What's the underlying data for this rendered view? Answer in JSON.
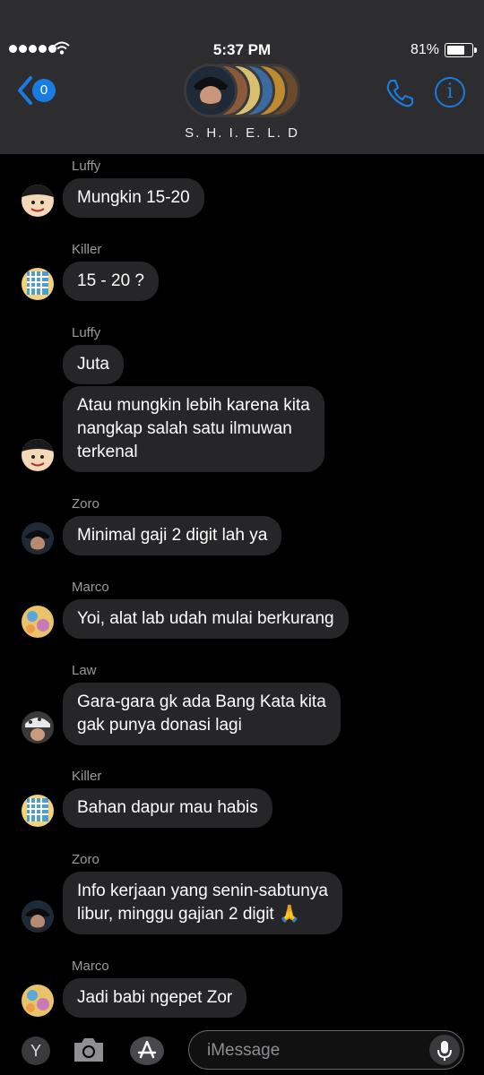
{
  "status": {
    "time": "5:37 PM",
    "battery": "81%",
    "battery_level": 0.81
  },
  "header": {
    "back_badge": "0",
    "group_name": "S. H. I. E. L. D",
    "info_label": "i"
  },
  "messages": [
    {
      "sender": "Luffy",
      "text": "Mungkin 15-20"
    },
    {
      "sender": "Killer",
      "text": "15 - 20  ?"
    },
    {
      "sender": "Luffy",
      "text": "Juta"
    },
    {
      "sender": "",
      "text": "Atau mungkin lebih karena kita\nnangkap salah satu ilmuwan\nterkenal"
    },
    {
      "sender": "Zoro",
      "text": "Minimal gaji 2 digit lah ya"
    },
    {
      "sender": "Marco",
      "text": "Yoi, alat lab udah mulai berkurang"
    },
    {
      "sender": "Law",
      "text": "Gara-gara gk ada Bang Kata kita\ngak punya donasi lagi"
    },
    {
      "sender": "Killer",
      "text": "Bahan dapur mau habis"
    },
    {
      "sender": "Zoro",
      "text": "Info kerjaan yang senin-sabtunya\nlibur, minggu gajian 2 digit 🙏"
    },
    {
      "sender": "Marco",
      "text": "Jadi babi ngepet Zor"
    }
  ],
  "input": {
    "placeholder": "iMessage",
    "app_y_label": "Y"
  },
  "colors": {
    "accent": "#1a7ce0",
    "bubble": "#262628",
    "header": "#2d2d2f"
  },
  "icons": [
    "back-chevron-icon",
    "phone-icon",
    "info-icon",
    "camera-icon",
    "app-store-icon",
    "microphone-icon",
    "wifi-icon",
    "battery-icon"
  ]
}
